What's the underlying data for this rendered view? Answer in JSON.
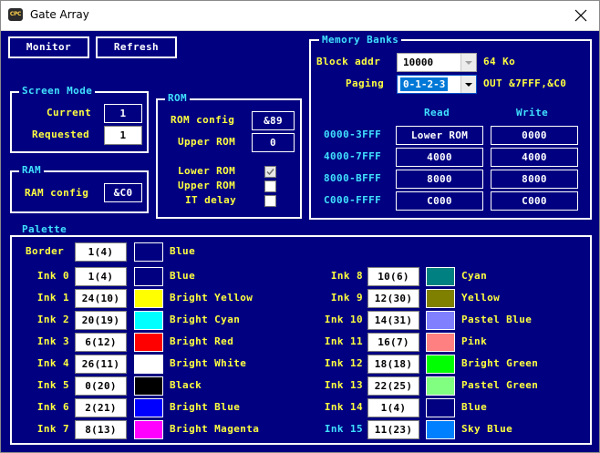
{
  "window": {
    "title": "Gate Array",
    "icon_text_top": "CPC"
  },
  "toolbar": {
    "monitor_label": "Monitor",
    "refresh_label": "Refresh"
  },
  "screen_mode": {
    "legend": "Screen Mode",
    "current_label": "Current",
    "current_value": "1",
    "requested_label": "Requested",
    "requested_value": "1"
  },
  "ram": {
    "legend": "RAM",
    "config_label": "RAM config",
    "config_value": "&C0"
  },
  "rom": {
    "legend": "ROM",
    "config_label": "ROM config",
    "config_value": "&89",
    "upper_label": "Upper ROM",
    "upper_value": "0",
    "lower_label": "Lower ROM",
    "lower_checked": true,
    "upper_chk_label": "Upper ROM",
    "upper_checked": false,
    "it_delay_label": "IT delay",
    "it_delay_checked": false
  },
  "memory_banks": {
    "legend": "Memory Banks",
    "block_addr_label": "Block addr",
    "block_addr_value": "10000",
    "block_addr_unit": "64 Ko",
    "paging_label": "Paging",
    "paging_value": "0-1-2-3",
    "paging_out": "OUT &7FFF,&C0",
    "read_header": "Read",
    "write_header": "Write",
    "rows": [
      {
        "range": "0000-3FFF",
        "read": "Lower ROM",
        "write": "0000"
      },
      {
        "range": "4000-7FFF",
        "read": "4000",
        "write": "4000"
      },
      {
        "range": "8000-BFFF",
        "read": "8000",
        "write": "8000"
      },
      {
        "range": "C000-FFFF",
        "read": "C000",
        "write": "C000"
      }
    ]
  },
  "palette": {
    "legend": "Palette",
    "border": {
      "label": "Border",
      "value": "1(4)",
      "color": "#000080",
      "name": "Blue"
    },
    "left": [
      {
        "label": "Ink 0",
        "value": "1(4)",
        "color": "#000080",
        "name": "Blue"
      },
      {
        "label": "Ink 1",
        "value": "24(10)",
        "color": "#ffff00",
        "name": "Bright Yellow"
      },
      {
        "label": "Ink 2",
        "value": "20(19)",
        "color": "#00ffff",
        "name": "Bright Cyan"
      },
      {
        "label": "Ink 3",
        "value": "6(12)",
        "color": "#ff0000",
        "name": "Bright Red"
      },
      {
        "label": "Ink 4",
        "value": "26(11)",
        "color": "#ffffff",
        "name": "Bright White"
      },
      {
        "label": "Ink 5",
        "value": "0(20)",
        "color": "#000000",
        "name": "Black"
      },
      {
        "label": "Ink 6",
        "value": "2(21)",
        "color": "#0000ff",
        "name": "Bright Blue"
      },
      {
        "label": "Ink 7",
        "value": "8(13)",
        "color": "#ff00ff",
        "name": "Bright Magenta"
      }
    ],
    "right": [
      {
        "label": "Ink 8",
        "value": "10(6)",
        "color": "#008080",
        "name": "Cyan"
      },
      {
        "label": "Ink 9",
        "value": "12(30)",
        "color": "#808000",
        "name": "Yellow"
      },
      {
        "label": "Ink 10",
        "value": "14(31)",
        "color": "#8080ff",
        "name": "Pastel Blue"
      },
      {
        "label": "Ink 11",
        "value": "16(7)",
        "color": "#ff8080",
        "name": "Pink"
      },
      {
        "label": "Ink 12",
        "value": "18(18)",
        "color": "#00ff00",
        "name": "Bright Green"
      },
      {
        "label": "Ink 13",
        "value": "22(25)",
        "color": "#80ff80",
        "name": "Pastel Green"
      },
      {
        "label": "Ink 14",
        "value": "1(4)",
        "color": "#000080",
        "name": "Blue"
      },
      {
        "label": "Ink 15",
        "value": "11(23)",
        "color": "#0080ff",
        "name": "Sky Blue"
      }
    ]
  }
}
